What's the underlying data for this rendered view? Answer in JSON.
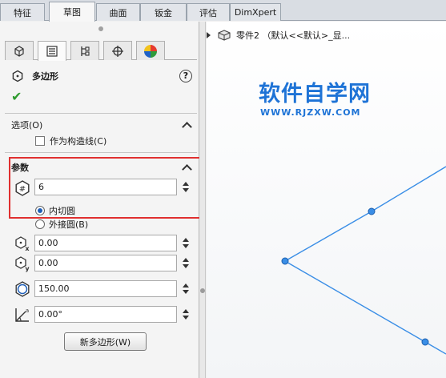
{
  "tabs": [
    {
      "label": "特征",
      "active": false
    },
    {
      "label": "草图",
      "active": true
    },
    {
      "label": "曲面",
      "active": false
    },
    {
      "label": "钣金",
      "active": false
    },
    {
      "label": "评估",
      "active": false
    },
    {
      "label": "DimXpert",
      "active": false
    }
  ],
  "panel": {
    "title": "多边形",
    "help": "?",
    "ok": "✔",
    "options": {
      "header": "选项(O)",
      "construction_label": "作为构造线(C)"
    },
    "params": {
      "header": "参数",
      "sides_value": "6",
      "inscribed_label": "内切圆",
      "circumscribed_label": "外接圆(B)",
      "center_x": "0.00",
      "center_y": "0.00",
      "diameter": "150.00",
      "angle": "0.00°"
    },
    "new_polygon_button": "新多边形(W)"
  },
  "viewport": {
    "tree_item": "零件2 （默认<<默认>_显...",
    "watermark_title": "软件自学网",
    "watermark_url": "WWW.RJZXW.COM"
  },
  "colors": {
    "accent": "#1e73d6",
    "highlight_border": "#e03030",
    "sketch_line": "#3a8ee6",
    "ok_green": "#2e9b2e"
  }
}
